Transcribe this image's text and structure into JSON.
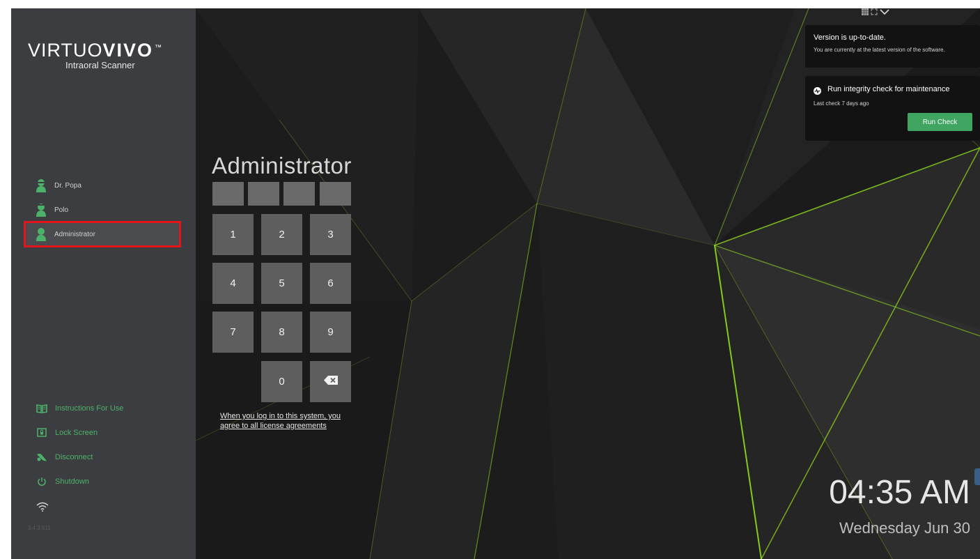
{
  "brand": {
    "name_light": "VIRTUO",
    "name_bold": "VIVO",
    "trademark": "™",
    "subtitle": "Intraoral Scanner"
  },
  "users": [
    {
      "name": "Dr. Popa",
      "icon": "user-doctor-icon"
    },
    {
      "name": "Polo",
      "icon": "user-person-icon"
    },
    {
      "name": "Administrator",
      "icon": "user-admin-icon",
      "selected": true
    }
  ],
  "menu": [
    {
      "label": "Instructions For Use",
      "icon": "book-icon"
    },
    {
      "label": "Lock Screen",
      "icon": "lock-screen-icon"
    },
    {
      "label": "Disconnect",
      "icon": "disconnect-icon"
    },
    {
      "label": "Shutdown",
      "icon": "power-icon"
    }
  ],
  "status": {
    "wifi_icon": "wifi-icon",
    "version": "3.4.3.611"
  },
  "login": {
    "title": "Administrator",
    "pin_length": 4,
    "keys": [
      "1",
      "2",
      "3",
      "4",
      "5",
      "6",
      "7",
      "8",
      "9",
      "0"
    ],
    "backspace_icon": "backspace-icon",
    "license_text": "When you log in to this system, you agree to all license agreements"
  },
  "cards": {
    "version": {
      "title": "Version is up-to-date.",
      "text": "You are currently at the latest version of the software."
    },
    "integrity": {
      "icon": "heartbeat-icon",
      "title": "Run integrity check for maintenance",
      "text": "Last check 7 days ago",
      "button": "Run Check"
    }
  },
  "clock": {
    "time": "04:35 AM",
    "date": "Wednesday Jun 30"
  },
  "colors": {
    "sidebar_bg": "#3c3d40",
    "accent_green": "#4cb26a",
    "button_green": "#3fa561",
    "selection_border": "#e3141b",
    "laser_green": "#8fdc1e"
  }
}
